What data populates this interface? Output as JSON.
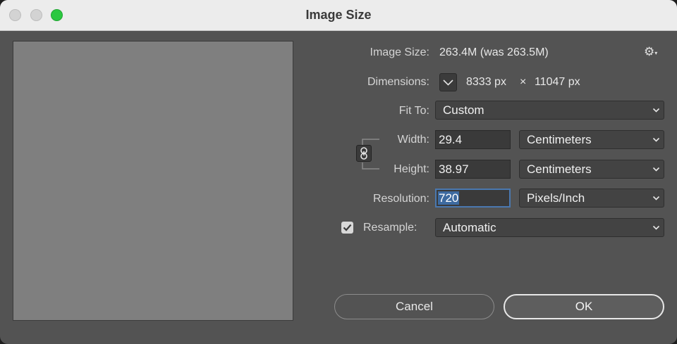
{
  "window": {
    "title": "Image Size",
    "buttons": {
      "close": "close",
      "minimize": "minimize",
      "maximize": "maximize"
    }
  },
  "info": {
    "image_size_label": "Image Size:",
    "image_size_value": "263.4M (was 263.5M)",
    "dimensions_label": "Dimensions:",
    "dimensions_width": "8333 px",
    "dimensions_times": "×",
    "dimensions_height": "11047 px"
  },
  "fit_to": {
    "label": "Fit To:",
    "value": "Custom"
  },
  "width": {
    "label": "Width:",
    "value": "29.4",
    "unit": "Centimeters"
  },
  "height": {
    "label": "Height:",
    "value": "38.97",
    "unit": "Centimeters"
  },
  "resolution": {
    "label": "Resolution:",
    "value": "720",
    "unit": "Pixels/Inch"
  },
  "resample": {
    "label": "Resample:",
    "checked": true,
    "value": "Automatic"
  },
  "actions": {
    "cancel": "Cancel",
    "ok": "OK"
  },
  "icons": {
    "settings": "gear-icon",
    "dimensions_toggle": "chevron-down-icon",
    "constrain": "link-icon",
    "checkbox": "checkmark-icon"
  },
  "colors": {
    "dialog_bg": "#535353",
    "preview_bg": "#7f7f7f",
    "focus": "#4a78b0",
    "maximize": "#2bc840"
  }
}
